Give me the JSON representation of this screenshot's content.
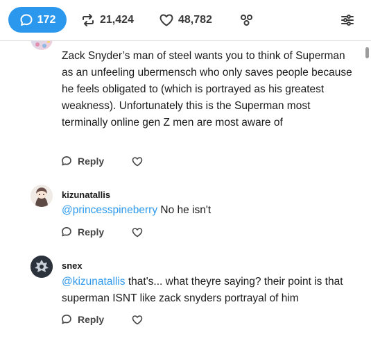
{
  "toolbar": {
    "comments_count": "172",
    "reblogs_count": "21,424",
    "likes_count": "48,782"
  },
  "comments": [
    {
      "username": "",
      "text": "Zack Snyder’s man of steel wants you to think of Superman as an unfeeling ubermensch who only saves people because he feels obligated to (which is portrayed as his greatest weakness). Unfortunately this is the Superman most terminally online gen Z men are most aware of",
      "reply_label": "Reply"
    },
    {
      "username": "kizunatallis",
      "mention": "@princesspineberry",
      "text": " No he isn't",
      "reply_label": "Reply"
    },
    {
      "username": "snex",
      "mention": "@kizunatallis",
      "text": " that's... what theyre saying? their point is that superman ISNT like zack snyders portrayal of him",
      "reply_label": "Reply"
    }
  ],
  "colors": {
    "accent": "#2b98ee",
    "text": "#1a1a1a",
    "muted": "#444444"
  }
}
